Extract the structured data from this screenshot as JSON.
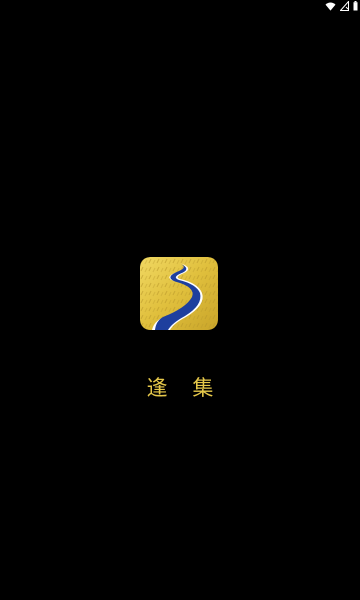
{
  "status_bar": {
    "icons": [
      "wifi-icon",
      "signal-icon",
      "battery-icon"
    ]
  },
  "app": {
    "name": "逢 集",
    "logo_icon": "winding-road-logo",
    "colors": {
      "background": "#000000",
      "logo_gold": "#e3c341",
      "logo_river": "#1e3f9e",
      "title_gold": "#e6c84a"
    }
  }
}
